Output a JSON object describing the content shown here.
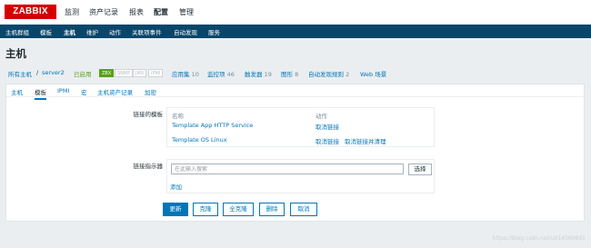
{
  "logo": "ZABBIX",
  "top_menu": [
    "监测",
    "资产记录",
    "报表",
    "配置",
    "管理"
  ],
  "sub_menu": [
    "主机群组",
    "模板",
    "主机",
    "维护",
    "动作",
    "关联项事件",
    "自动发现",
    "服务"
  ],
  "page_title": "主机",
  "breadcrumb": {
    "all_hosts": "所有主机",
    "sep": "/",
    "host": "server2",
    "status": "已启用",
    "badges": [
      "ZBX",
      "SNMP",
      "JMX",
      "IPMI"
    ],
    "links": [
      {
        "label": "应用集",
        "count": "10"
      },
      {
        "label": "监控项",
        "count": "46"
      },
      {
        "label": "触发器",
        "count": "19"
      },
      {
        "label": "图形",
        "count": "8"
      },
      {
        "label": "自动发现规则",
        "count": "2"
      },
      {
        "label": "Web 场景",
        "count": ""
      }
    ]
  },
  "tabs": [
    "主机",
    "模板",
    "IPMI",
    "宏",
    "主机资产记录",
    "加密"
  ],
  "form": {
    "linked_label": "链接的模板",
    "col_name": "名称",
    "col_action": "动作",
    "rows": [
      {
        "name": "Template App HTTP Service",
        "unlink": "取消链接",
        "unlink_clear": ""
      },
      {
        "name": "Template OS Linux",
        "unlink": "取消链接",
        "unlink_clear": "取消链接并清理"
      }
    ],
    "indicator_label": "链接指示器",
    "search_placeholder": "在此输入搜索",
    "select_label": "选择",
    "add_label": "添加"
  },
  "buttons": {
    "update": "更新",
    "clone": "克隆",
    "full_clone": "全克隆",
    "delete": "删除",
    "cancel": "取消"
  },
  "watermark": "https://blog.csdn.net/u014560691"
}
